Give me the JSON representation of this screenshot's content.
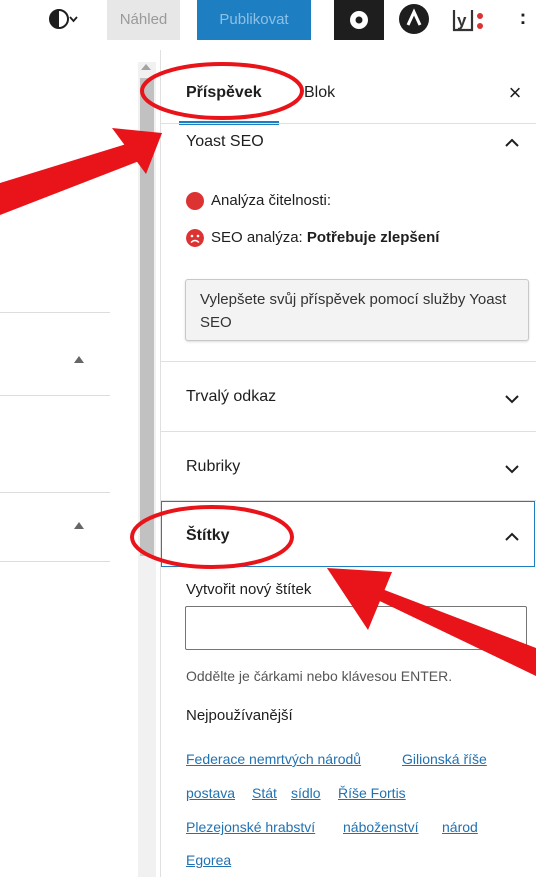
{
  "toolbar": {
    "contrast_icon": "half-circle-contrast-icon",
    "preview_label": "Náhled",
    "publish_label": "Publikovat",
    "settings_icon": "gear-icon",
    "more_icon": "vertical-dots-icon",
    "more_label": ":"
  },
  "sidebar": {
    "tab_post": "Příspěvek",
    "tab_block": "Blok",
    "close_label": "×",
    "yoast": {
      "title": "Yoast SEO",
      "readability_label": "Analýza čitelnosti:",
      "seo_label": "SEO analýza:",
      "seo_status": "Potřebuje zlepšení",
      "help_text": "Vylepšete svůj příspěvek pomocí služby Yoast SEO"
    },
    "permalink_title": "Trvalý odkaz",
    "categories_title": "Rubriky",
    "tags": {
      "title": "Štítky",
      "new_tag_label": "Vytvořit nový štítek",
      "input_value": "",
      "hint": "Oddělte je čárkami nebo klávesou ENTER.",
      "most_used_title": "Nejpoužívanější",
      "items": [
        "Federace nemrtvých národů",
        "Gilionská říše",
        "postava",
        "Stát",
        "sídlo",
        "Říše Fortis",
        "Plezejonské hrabství",
        "náboženství",
        "národ",
        "Egorea"
      ]
    }
  },
  "colors": {
    "accent": "#1e7ec2",
    "annotation": "#e8141a",
    "status_red": "#dc3232"
  }
}
